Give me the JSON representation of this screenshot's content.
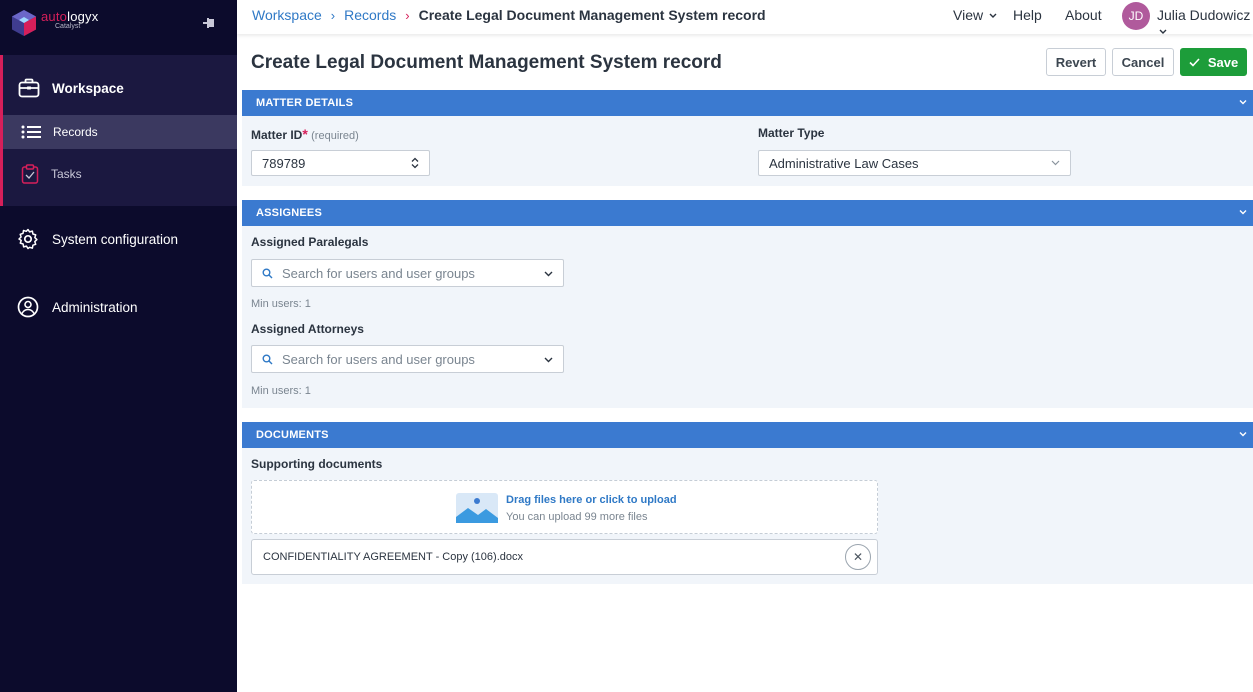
{
  "brand": {
    "name_part1": "auto",
    "name_part2": "logyx",
    "sub": "Catalyst"
  },
  "sidebar": {
    "workspace_label": "Workspace",
    "records_label": "Records",
    "tasks_label": "Tasks",
    "system_config_label": "System configuration",
    "administration_label": "Administration",
    "active_accent": "#d61f5a"
  },
  "topbar": {
    "breadcrumb": [
      "Workspace",
      "Records",
      "Create Legal Document Management System record"
    ],
    "view_label": "View",
    "help_label": "Help",
    "about_label": "About",
    "user_initials": "JD",
    "user_name": "Julia Dudowicz"
  },
  "page": {
    "title": "Create Legal Document Management System record",
    "revert_label": "Revert",
    "cancel_label": "Cancel",
    "save_label": "Save"
  },
  "sections": {
    "matter": {
      "header": "MATTER DETAILS",
      "matter_id_label": "Matter ID",
      "required_mark": "*",
      "required_hint": "(required)",
      "matter_id_value": "789789",
      "matter_type_label": "Matter Type",
      "matter_type_value": "Administrative Law Cases"
    },
    "assignees": {
      "header": "ASSIGNEES",
      "paralegals_label": "Assigned Paralegals",
      "paralegals_placeholder": "Search for users and user groups",
      "paralegals_min": "Min users: 1",
      "attorneys_label": "Assigned Attorneys",
      "attorneys_placeholder": "Search for users and user groups",
      "attorneys_min": "Min users: 1"
    },
    "documents": {
      "header": "DOCUMENTS",
      "supporting_label": "Supporting documents",
      "upload_title": "Drag files here or click to upload",
      "upload_sub": "You can upload 99 more files",
      "file_name": "CONFIDENTIALITY AGREEMENT - Copy (106).docx",
      "remove_symbol": "✕"
    }
  },
  "colors": {
    "sidebar_bg": "#0c0b2c",
    "section_header": "#3b7ad0",
    "save_green": "#1d9d3a",
    "link_blue": "#2f79c6"
  }
}
